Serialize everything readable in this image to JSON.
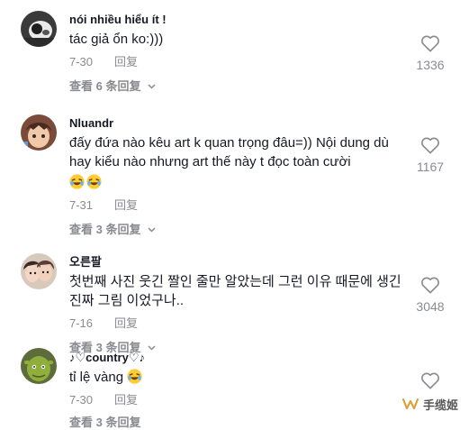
{
  "comments": [
    {
      "username": "nói nhiều hiểu ít !",
      "text": "tác giả ổn ko:)))",
      "date": "7-30",
      "reply_label": "回复",
      "likes": "1336",
      "view_replies": "查看 6 条回复",
      "avatar_icon": "avatar-dark-animal",
      "emoji": []
    },
    {
      "username": "Nluandr",
      "text": "đấy đứa nào kêu art k quan trọng đâu=)) Nội dung dù hay kiểu nào nhưng art thế này t đọc toàn cười",
      "date": "7-31",
      "reply_label": "回复",
      "likes": "1167",
      "view_replies": "查看 3 条回复",
      "avatar_icon": "avatar-anime-character",
      "emoji": [
        "laughing-emoji",
        "laughing-emoji"
      ]
    },
    {
      "username": "오른팔",
      "text": "첫번째 사진 웃긴 짤인 줄만 알았는데 그런 이유 때문에 생긴 진짜 그림 이었구나..",
      "date": "7-16",
      "reply_label": "回复",
      "likes": "3048",
      "view_replies": "查看 3 条回复",
      "avatar_icon": "avatar-two-people-photo",
      "emoji": []
    },
    {
      "username": "♪♡country♡♪",
      "text": "tỉ lệ vàng",
      "date": "7-30",
      "reply_label": "回复",
      "likes": "",
      "view_replies": "查看 3 条回复",
      "avatar_icon": "avatar-shrek",
      "emoji": [
        "laughing-emoji"
      ]
    }
  ],
  "watermark": {
    "text": "手缆姬",
    "icon": "wechat-channel-icon"
  },
  "colors": {
    "text_primary": "#161823",
    "text_secondary": "#8a8b91",
    "emoji_face": "#ffcc33"
  }
}
